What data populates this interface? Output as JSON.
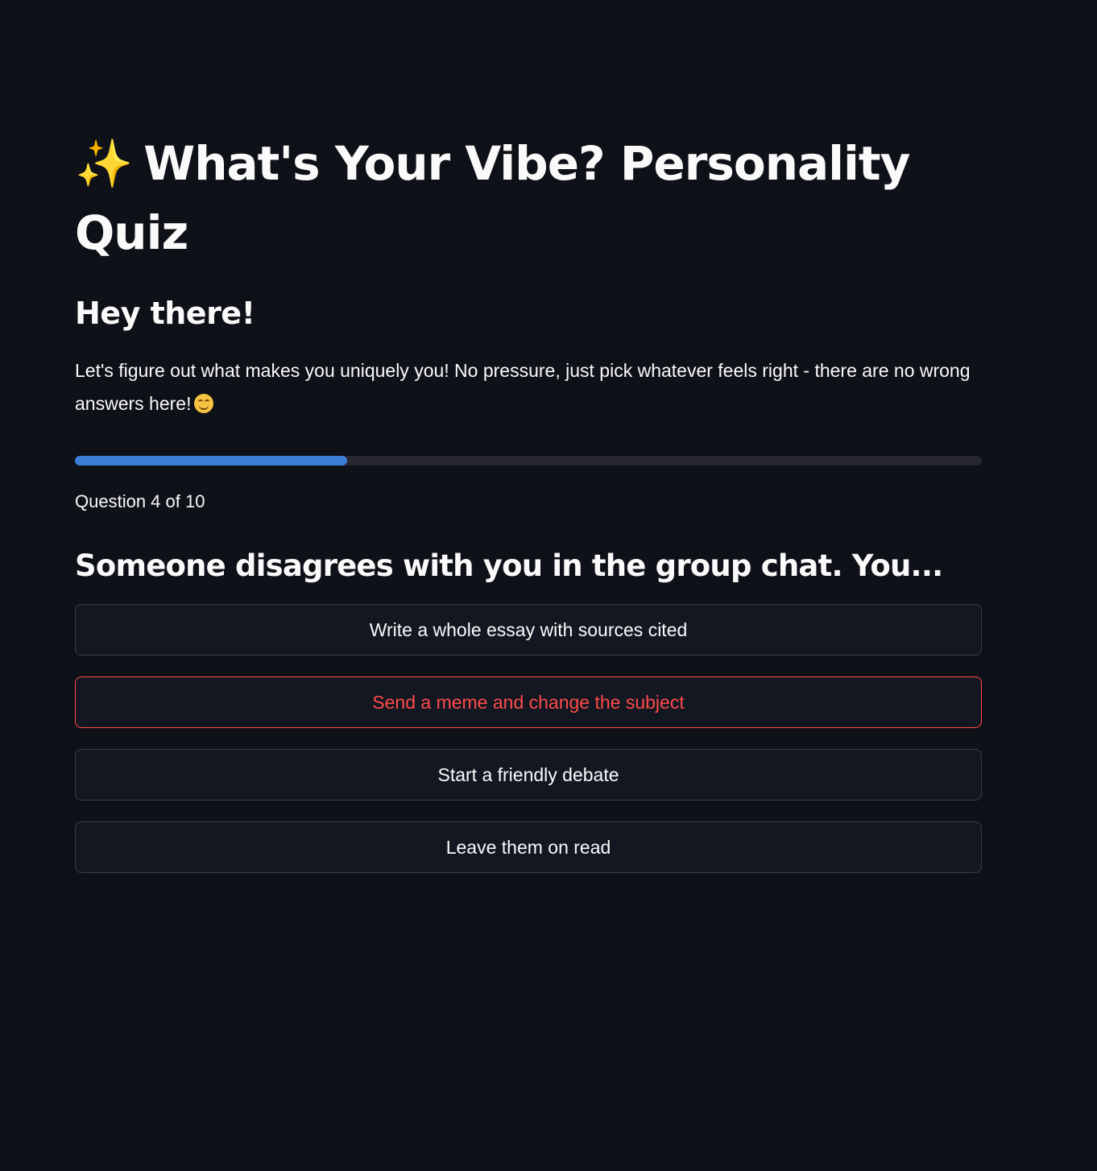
{
  "header": {
    "title_icon": "sparkles-icon",
    "title": "What's Your Vibe? Personality Quiz"
  },
  "intro": {
    "heading": "Hey there!",
    "text": "Let's figure out what makes you uniquely you! No pressure, just pick whatever feels right - there are no wrong answers here!",
    "emoji_icon": "smiling-face-icon"
  },
  "progress": {
    "current": 4,
    "total": 10,
    "fill_fraction": 0.3,
    "label": "Question 4 of 10",
    "fill_color": "#3d7ed7"
  },
  "question": {
    "text": "Someone disagrees with you in the group chat. You...",
    "options": [
      "Write a whole essay with sources cited",
      "Send a meme and change the subject",
      "Start a friendly debate",
      "Leave them on read"
    ],
    "hovered_option_index": 1,
    "hover_color": "#ff4b4b"
  }
}
